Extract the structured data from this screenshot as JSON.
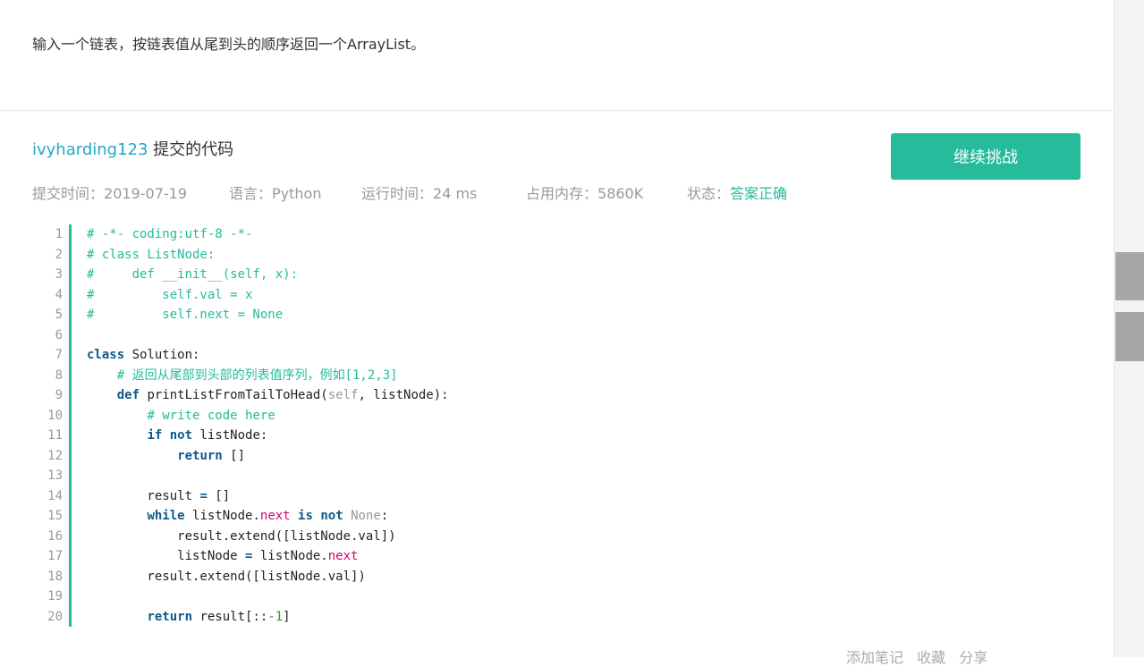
{
  "problem": {
    "text": "输入一个链表，按链表值从尾到头的顺序返回一个ArrayList。"
  },
  "submission": {
    "user": "ivyharding123",
    "title_suffix": " 提交的代码",
    "submit_time_label": "提交时间：",
    "submit_time": "2019-07-19",
    "language_label": "语言：",
    "language": "Python",
    "runtime_label": "运行时间：",
    "runtime": "24 ms",
    "memory_label": "占用内存：",
    "memory": "5860K",
    "status_label": "状态：",
    "status": "答案正确"
  },
  "buttons": {
    "continue": "继续挑战"
  },
  "footer": {
    "add_note": "添加笔记",
    "favorite": "收藏",
    "share": "分享"
  },
  "colors": {
    "accent": "#25bb9b",
    "link": "#25a8c6",
    "keyword": "#0d5a8a",
    "property": "#d6006f"
  },
  "code": {
    "line_numbers": [
      "1",
      "2",
      "3",
      "4",
      "5",
      "6",
      "7",
      "8",
      "9",
      "10",
      "11",
      "12",
      "13",
      "14",
      "15",
      "16",
      "17",
      "18",
      "19",
      "20"
    ],
    "lines": [
      [
        {
          "t": "# -*- coding:utf-8 -*-",
          "c": "c"
        }
      ],
      [
        {
          "t": "# class ListNode:",
          "c": "c"
        }
      ],
      [
        {
          "t": "#     def __init__(self, x):",
          "c": "c"
        }
      ],
      [
        {
          "t": "#         self.val = x",
          "c": "c"
        }
      ],
      [
        {
          "t": "#         self.next = None",
          "c": "c"
        }
      ],
      [],
      [
        {
          "t": "class",
          "c": "k"
        },
        {
          "t": " Solution:",
          "c": ""
        }
      ],
      [
        {
          "t": "    ",
          "c": ""
        },
        {
          "t": "# 返回从尾部到头部的列表值序列，例如[1,2,3]",
          "c": "c"
        }
      ],
      [
        {
          "t": "    ",
          "c": ""
        },
        {
          "t": "def",
          "c": "k"
        },
        {
          "t": " printListFromTailToHead(",
          "c": ""
        },
        {
          "t": "self",
          "c": "s"
        },
        {
          "t": ", listNode):",
          "c": ""
        }
      ],
      [
        {
          "t": "        ",
          "c": ""
        },
        {
          "t": "# write code here",
          "c": "c"
        }
      ],
      [
        {
          "t": "        ",
          "c": ""
        },
        {
          "t": "if",
          "c": "k"
        },
        {
          "t": " ",
          "c": ""
        },
        {
          "t": "not",
          "c": "k"
        },
        {
          "t": " listNode:",
          "c": ""
        }
      ],
      [
        {
          "t": "            ",
          "c": ""
        },
        {
          "t": "return",
          "c": "k"
        },
        {
          "t": " []",
          "c": ""
        }
      ],
      [],
      [
        {
          "t": "        result ",
          "c": ""
        },
        {
          "t": "=",
          "c": "k"
        },
        {
          "t": " []",
          "c": ""
        }
      ],
      [
        {
          "t": "        ",
          "c": ""
        },
        {
          "t": "while",
          "c": "k"
        },
        {
          "t": " listNode.",
          "c": ""
        },
        {
          "t": "next",
          "c": "p"
        },
        {
          "t": " ",
          "c": ""
        },
        {
          "t": "is",
          "c": "k"
        },
        {
          "t": " ",
          "c": ""
        },
        {
          "t": "not",
          "c": "k"
        },
        {
          "t": " ",
          "c": ""
        },
        {
          "t": "None",
          "c": "s"
        },
        {
          "t": ":",
          "c": ""
        }
      ],
      [
        {
          "t": "            result.extend([listNode.val])",
          "c": ""
        }
      ],
      [
        {
          "t": "            listNode ",
          "c": ""
        },
        {
          "t": "=",
          "c": "k"
        },
        {
          "t": " listNode.",
          "c": ""
        },
        {
          "t": "next",
          "c": "p"
        }
      ],
      [
        {
          "t": "        result.extend([listNode.val])",
          "c": ""
        }
      ],
      [],
      [
        {
          "t": "        ",
          "c": ""
        },
        {
          "t": "return",
          "c": "k"
        },
        {
          "t": " result[::",
          "c": ""
        },
        {
          "t": "-1",
          "c": "n"
        },
        {
          "t": "]",
          "c": ""
        }
      ]
    ]
  }
}
